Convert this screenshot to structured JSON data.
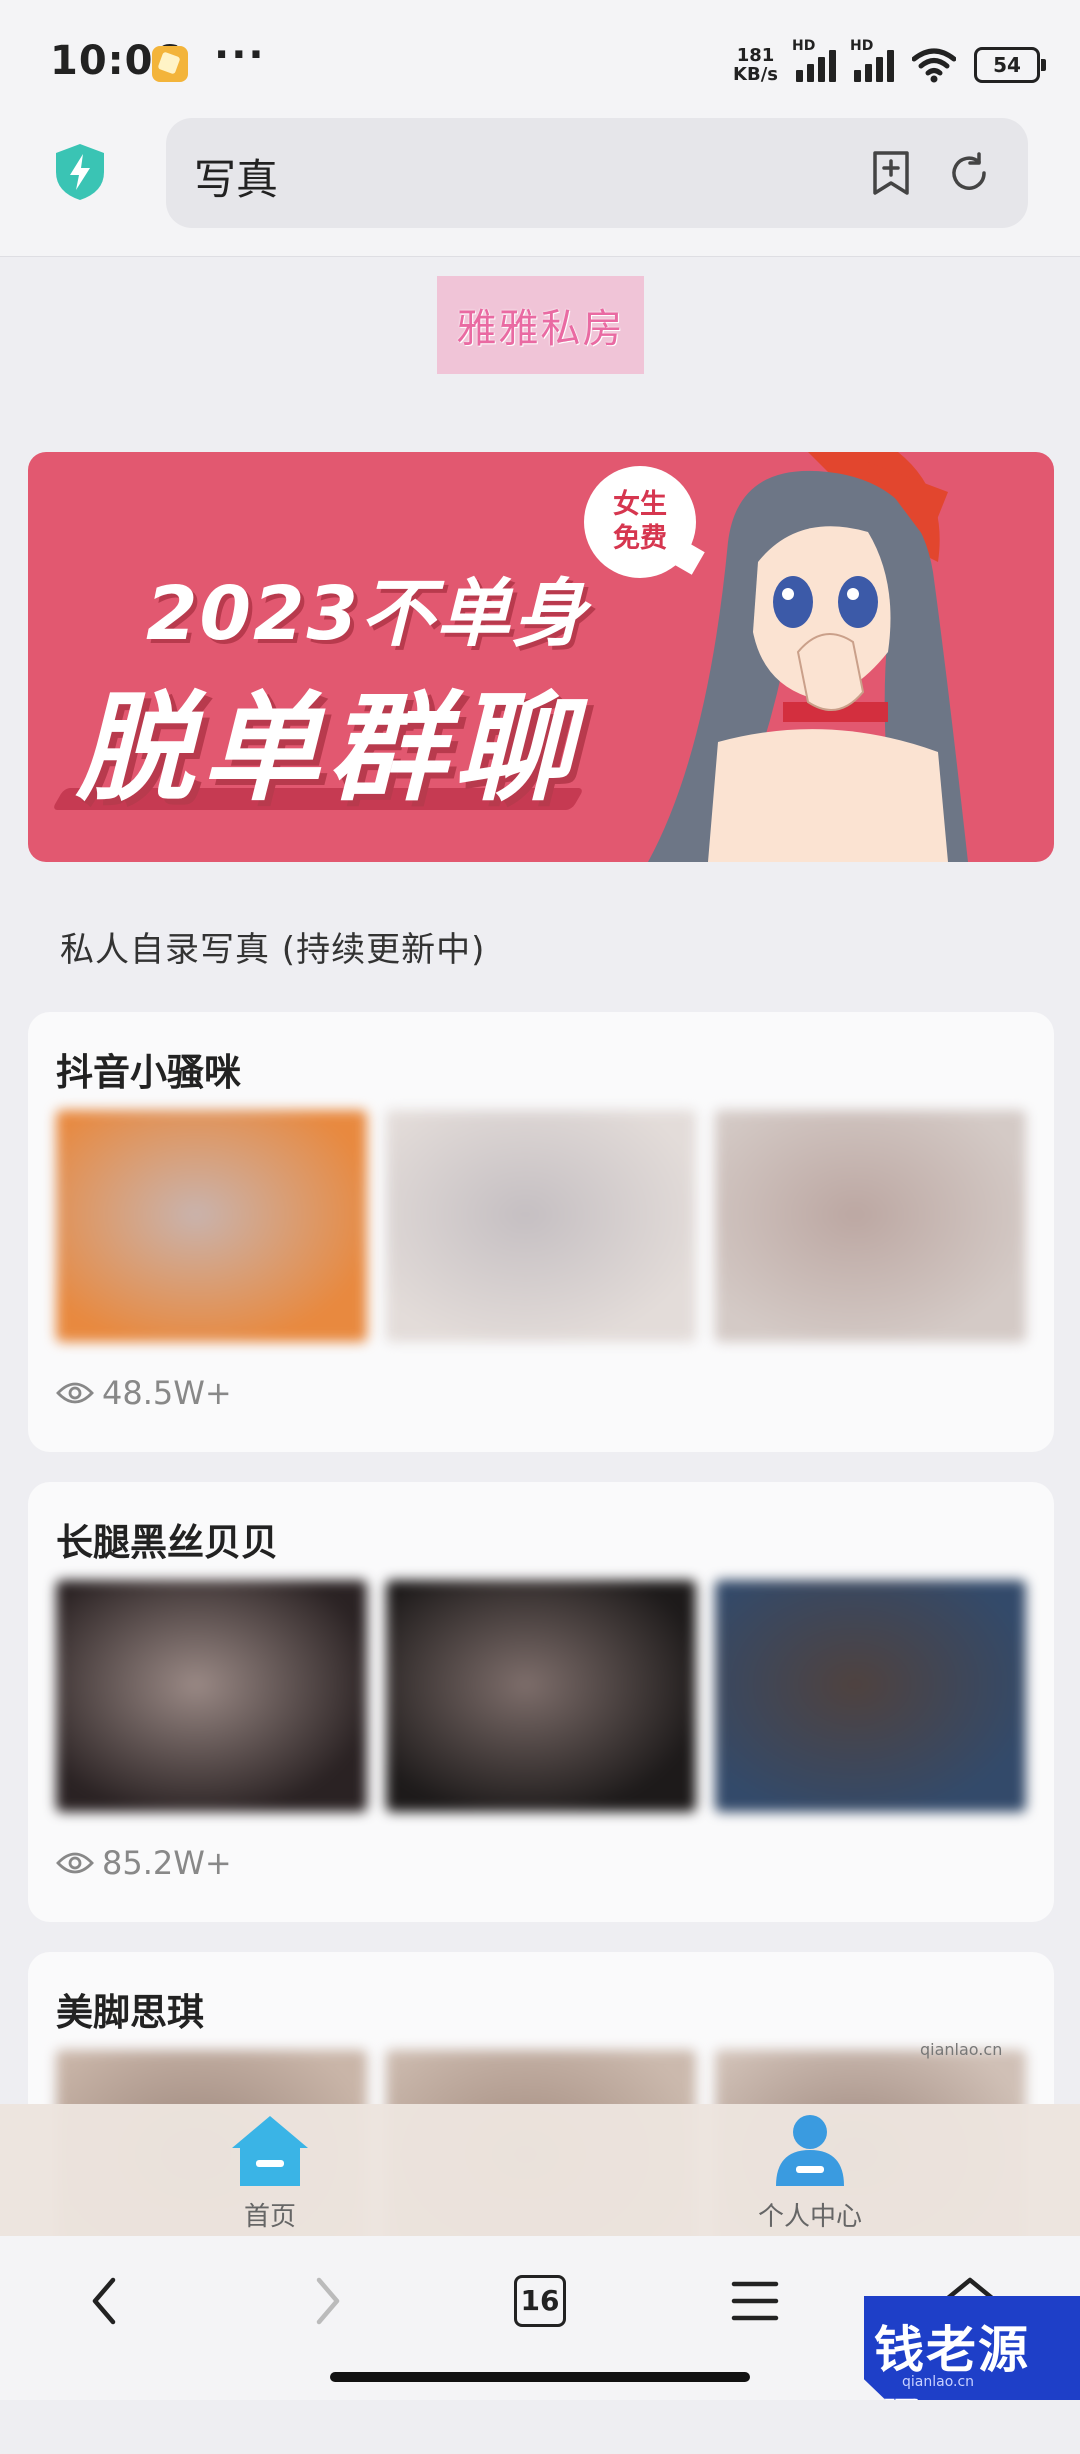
{
  "status_bar": {
    "time": "10:06",
    "more": "···",
    "net_speed_value": "181",
    "net_speed_unit": "KB/s",
    "hd_label": "HD",
    "battery": "54"
  },
  "browser": {
    "address_text": "写真",
    "tab_count": "16"
  },
  "site": {
    "logo_text": "雅雅私房",
    "banner": {
      "line1": "2023不单身",
      "line2": "脱单群聊",
      "bubble_line1": "女生",
      "bubble_line2": "免费"
    },
    "section_title": "私人自录写真 (持续更新中)",
    "albums": [
      {
        "title": "抖音小骚咪",
        "views": "48.5W+",
        "thumb_colors": [
          [
            "#c9b3ad",
            "#e8893f"
          ],
          [
            "#c5bfc2",
            "#e3dcd9"
          ],
          [
            "#bca7a2",
            "#d4cac6"
          ]
        ]
      },
      {
        "title": "长腿黑丝贝贝",
        "views": "85.2W+",
        "thumb_colors": [
          [
            "#9a8985",
            "#2a2223"
          ],
          [
            "#7e6e6b",
            "#1d1a1a"
          ],
          [
            "#4f423f",
            "#334a6a"
          ]
        ]
      },
      {
        "title": "美脚思琪",
        "views": "",
        "thumb_colors": [
          [
            "#9b857b",
            "#c9b5a8"
          ],
          [
            "#a38b7f",
            "#cbb9ad"
          ],
          [
            "#9e877d",
            "#d0c0b6"
          ]
        ]
      }
    ],
    "tabs": {
      "home": "首页",
      "profile": "个人中心"
    }
  },
  "watermark": {
    "text": "钱老源码",
    "sub": "qianlao.cn"
  },
  "colors": {
    "banner_bg": "#e25870",
    "tab_icon": "#3a9be0",
    "shield": "#3ac4b4",
    "watermark_bg": "#1e3fc8"
  }
}
